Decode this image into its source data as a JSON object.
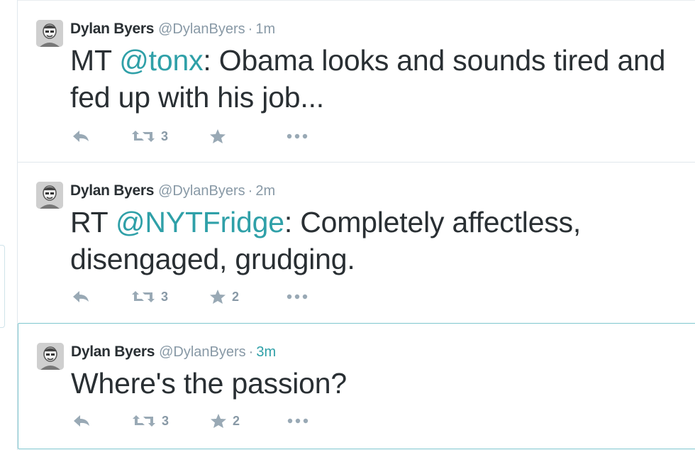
{
  "tweets": [
    {
      "name": "Dylan Byers",
      "handle": "@DylanByers",
      "separator": "·",
      "time": "1m",
      "text_prefix": "MT ",
      "mention": "@tonx",
      "text_suffix": ": Obama looks and sounds tired and fed up with his job...",
      "retweet_count": "3",
      "favorite_count": ""
    },
    {
      "name": "Dylan Byers",
      "handle": "@DylanByers",
      "separator": "·",
      "time": "2m",
      "text_prefix": "RT ",
      "mention": "@NYTFridge",
      "text_suffix": ": Completely affectless, disengaged, grudging.",
      "retweet_count": "3",
      "favorite_count": "2"
    },
    {
      "name": "Dylan Byers",
      "handle": "@DylanByers",
      "separator": "·",
      "time": "3m",
      "text_prefix": "Where's the passion?",
      "mention": "",
      "text_suffix": "",
      "retweet_count": "3",
      "favorite_count": "2"
    }
  ],
  "icons": {
    "reply": "reply-icon",
    "retweet": "retweet-icon",
    "favorite": "star-icon",
    "more": "more-icon"
  },
  "colors": {
    "link": "#2fa0a8",
    "text": "#292f33",
    "meta": "#8899a6",
    "selected_border": "#7fc7cf"
  }
}
